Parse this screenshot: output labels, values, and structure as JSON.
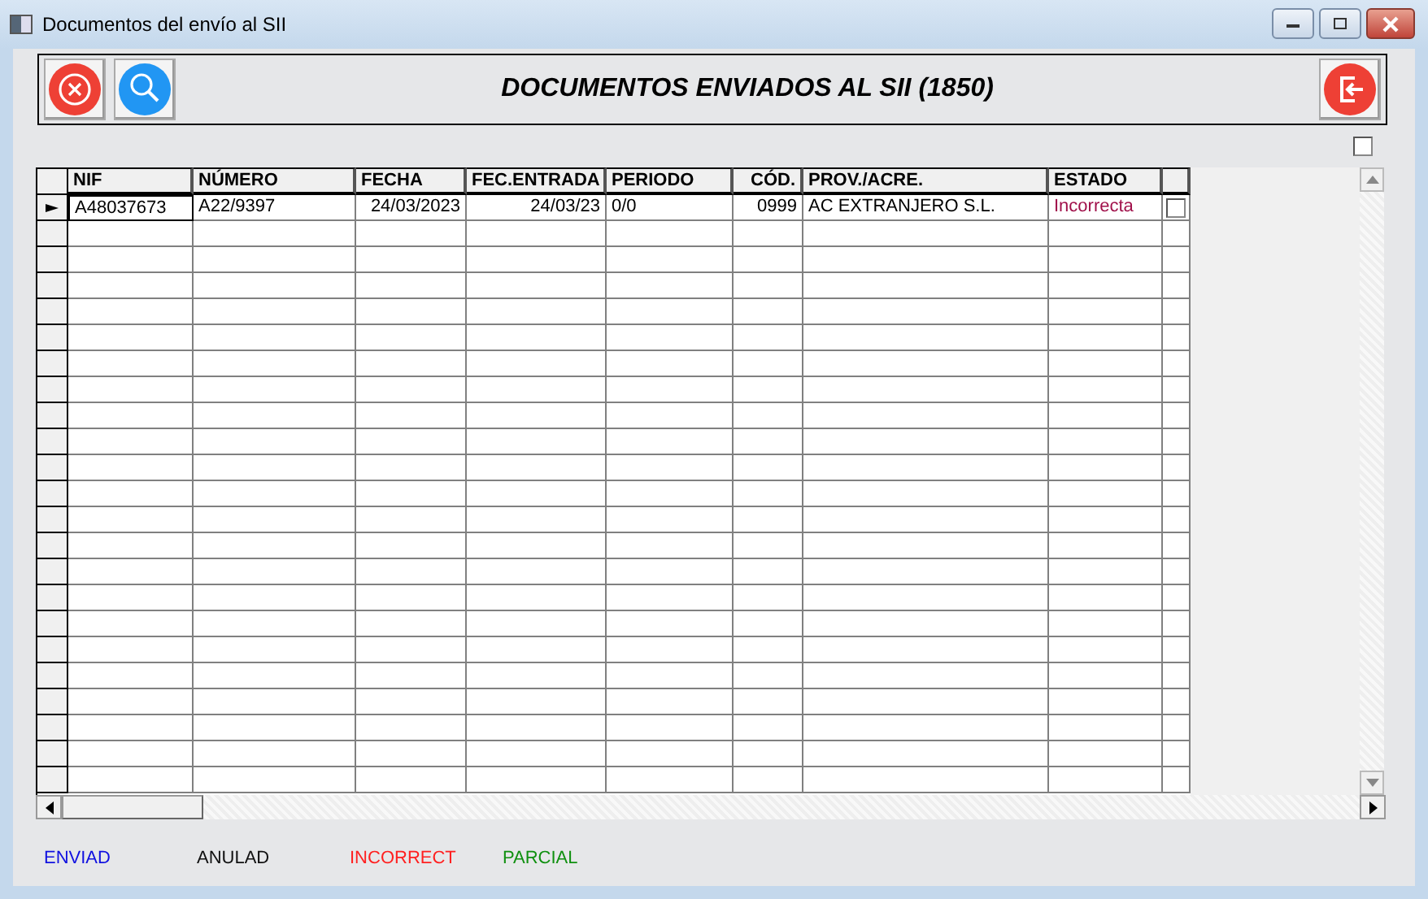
{
  "window": {
    "title": "Documentos del envío al SII"
  },
  "toolbar": {
    "title": "DOCUMENTOS ENVIADOS AL SII (1850)"
  },
  "select_all": {
    "checked": false
  },
  "table": {
    "columns": [
      "NIF",
      "NÚMERO",
      "FECHA",
      "FEC.ENTRADA",
      "PERIODO",
      "CÓD.",
      "PROV./ACRE.",
      "ESTADO"
    ],
    "rows": [
      {
        "selected": true,
        "checked": false,
        "cells": [
          "A48037673",
          "A22/9397",
          "24/03/2023",
          "24/03/23",
          "0/0",
          "0999",
          "AC EXTRANJERO S.L.",
          "Incorrecta"
        ]
      }
    ]
  },
  "legend": [
    {
      "label": "ENVIAD",
      "color": "#1010e0"
    },
    {
      "label": "ANULAD",
      "color": "#101010"
    },
    {
      "label": "INCORRECT",
      "color": "#ff2020"
    },
    {
      "label": "PARCIAL",
      "color": "#109010"
    }
  ]
}
